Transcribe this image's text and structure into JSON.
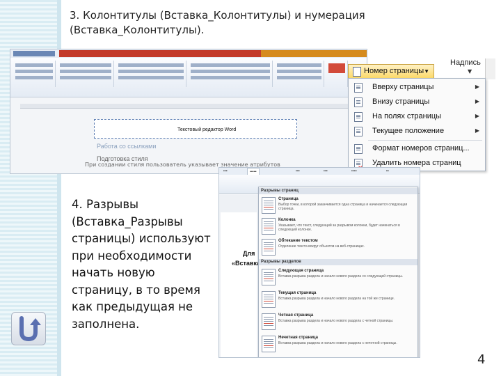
{
  "slide": {
    "title": "3. Колонтитулы (Вставка_Колонтитулы) и нумерация (Вставка_Колонтитулы).",
    "paragraph": "4. Разрывы (Вставка_Разрывы страницы) используют при необходимости начать новую страницу, в то время как предыдущая не заполнена.",
    "page_number": "4"
  },
  "header_screenshot": {
    "header_text": "Текстовый редактор Word",
    "faded_text_1": "Работа со ссылками",
    "faded_text_2": "Подготовка стиля",
    "faded_text_3": "При создании стиля пользователь указывает значение атрибутов"
  },
  "page_number_dropdown": {
    "button_label": "Номер страницы",
    "text_box_label": "Надпись",
    "items": [
      {
        "label": "Вверху страницы",
        "has_submenu": true
      },
      {
        "label": "Внизу страницы",
        "has_submenu": true
      },
      {
        "label": "На полях страницы",
        "has_submenu": true
      },
      {
        "label": "Текущее положение",
        "has_submenu": true
      },
      {
        "label": "Формат номеров страниц...",
        "has_submenu": false
      },
      {
        "label": "Удалить номера страниц",
        "has_submenu": false
      }
    ]
  },
  "breaks_screenshot": {
    "page_text_1": "Для",
    "page_text_2": "«Вставка",
    "page_breaks_section": "Разрывы страниц",
    "section_breaks_section": "Разрывы разделов",
    "page_breaks": [
      {
        "title": "Страница",
        "desc": "Выбор точки, в которой заканчивается одна страница и начинается следующая страница."
      },
      {
        "title": "Колонка",
        "desc": "Указывает, что текст, следующий за разрывом колонки, будет начинаться в следующей колонке."
      },
      {
        "title": "Обтекание текстом",
        "desc": "Отделение текста вокруг объектов на веб-страницах."
      }
    ],
    "section_breaks": [
      {
        "title": "Следующая страница",
        "desc": "Вставка разрыва раздела и начало нового раздела со следующей страницы."
      },
      {
        "title": "Текущая страница",
        "desc": "Вставка разрыва раздела и начало нового раздела на той же странице."
      },
      {
        "title": "Четная страница",
        "desc": "Вставка разрыва раздела и начало нового раздела с четной страницы."
      },
      {
        "title": "Нечетная страница",
        "desc": "Вставка разрыва раздела и начало нового раздела с нечетной страницы."
      }
    ]
  }
}
